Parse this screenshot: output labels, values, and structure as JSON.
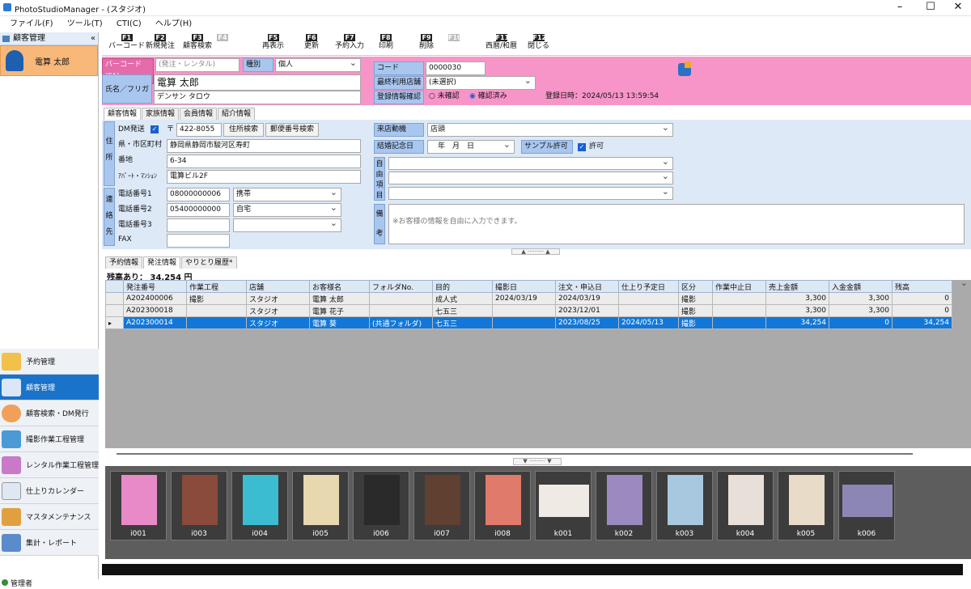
{
  "window": {
    "title": "PhotoStudioManager - (スタジオ)"
  },
  "menu": [
    "ファイル(F)",
    "ツール(T)",
    "CTI(C)",
    "ヘルプ(H)"
  ],
  "sidebar": {
    "header": "顧客管理",
    "collapse": "«",
    "customer_name": "電算 太郎",
    "nav": [
      {
        "label": "予約管理"
      },
      {
        "label": "顧客管理"
      },
      {
        "label": "顧客検索・DM発行"
      },
      {
        "label": "撮影作業工程管理"
      },
      {
        "label": "レンタル作業工程管理"
      },
      {
        "label": "仕上りカレンダー"
      },
      {
        "label": "マスタメンテナンス"
      },
      {
        "label": "集計・レポート"
      }
    ]
  },
  "fkeys": [
    {
      "key": "F1",
      "label": "バーコード"
    },
    {
      "key": "F2",
      "label": "新規発注"
    },
    {
      "key": "F3",
      "label": "顧客検索"
    },
    {
      "key": "F4",
      "label": ""
    },
    {
      "key": "F5",
      "label": "再表示"
    },
    {
      "key": "F6",
      "label": "更新"
    },
    {
      "key": "F7",
      "label": "予約入力"
    },
    {
      "key": "F8",
      "label": "印刷"
    },
    {
      "key": "F9",
      "label": "削除"
    },
    {
      "key": "F10",
      "label": ""
    },
    {
      "key": "F11",
      "label": "西暦/和暦"
    },
    {
      "key": "F12",
      "label": "閉じる"
    }
  ],
  "header": {
    "barcode_label": "バーコード(F1)",
    "barcode_placeholder": "(発注・レンタル)",
    "type_label": "種別",
    "type_value": "個人",
    "name_label": "氏名／フリガナ",
    "name": "電算 太郎",
    "kana": "デンサン タロウ",
    "code_label": "コード",
    "code": "0000030",
    "last_store_label": "最終利用店舗",
    "last_store": "(未選択)",
    "confirm_label": "登録情報確認",
    "unconfirmed": "未確認",
    "confirmed": "確認済み",
    "registered": "登録日時：2024/05/13 13:59:54"
  },
  "tabs_top": [
    "顧客情報",
    "家族情報",
    "会員情報",
    "紹介情報"
  ],
  "address": {
    "dm_label": "DM発送",
    "zip_mark": "〒",
    "zip": "422-8055",
    "btn_addr": "住所検索",
    "btn_zip": "郵便番号検索",
    "side": "住所",
    "pref_label": "県・市区町村",
    "pref": "静岡県静岡市駿河区寿町",
    "street_label": "番地",
    "street": "6-34",
    "apt_label": "ｱﾊﾟｰﾄ・ﾏﾝｼｮﾝ",
    "apt": "電算ビル2F"
  },
  "contact": {
    "side": "連絡先",
    "rows": [
      {
        "label": "電話番号1",
        "value": "08000000006",
        "type": "携帯"
      },
      {
        "label": "電話番号2",
        "value": "05400000000",
        "type": "自宅"
      },
      {
        "label": "電話番号3",
        "value": "",
        "type": ""
      },
      {
        "label": "FAX",
        "value": "",
        "type": null
      }
    ]
  },
  "right": {
    "visit_label": "来店動機",
    "visit": "店頭",
    "anniv_label": "結婚記念日",
    "anniv": "　年　月　日",
    "sample_label": "サンプル許可",
    "sample_value": "許可",
    "free_label": "自由項目",
    "memo_label": "備考",
    "memo_placeholder": "※お客様の情報を自由に入力できます。"
  },
  "tabs_bottom": [
    "予約情報",
    "発注情報",
    "やりとり履歴*"
  ],
  "balance": "残高あり： 34,254 円",
  "grid": {
    "columns": [
      "発注番号",
      "作業工程",
      "店舗",
      "お客様名",
      "フォルダNo.",
      "目的",
      "撮影日",
      "注文・申込日",
      "仕上り予定日",
      "区分",
      "作業中止日",
      "売上金額",
      "入金金額",
      "残高"
    ],
    "rows": [
      [
        "A202400006",
        "撮影",
        "スタジオ",
        "電算 太郎",
        "",
        "成人式",
        "2024/03/19",
        "2024/03/19",
        "",
        "撮影",
        "",
        "3,300",
        "3,300",
        "0"
      ],
      [
        "A202300018",
        "",
        "スタジオ",
        "電算 花子",
        "",
        "七五三",
        "",
        "2023/12/01",
        "",
        "撮影",
        "",
        "3,300",
        "3,300",
        "0"
      ],
      [
        "A202300014",
        "",
        "スタジオ",
        "電算 葵",
        "(共通フォルダ)",
        "七五三",
        "",
        "2023/08/25",
        "2024/05/13",
        "撮影",
        "",
        "34,254",
        "0",
        "34,254"
      ]
    ]
  },
  "thumbs": [
    {
      "label": "i001",
      "color": "#e88ac8"
    },
    {
      "label": "i003",
      "color": "#8a4a3c"
    },
    {
      "label": "i004",
      "color": "#3cbcd0"
    },
    {
      "label": "i005",
      "color": "#e8d8b0"
    },
    {
      "label": "i006",
      "color": "#2a2a2a"
    },
    {
      "label": "i007",
      "color": "#604030"
    },
    {
      "label": "i008",
      "color": "#e07a6a"
    },
    {
      "label": "k001",
      "color": "#f0eae4"
    },
    {
      "label": "k002",
      "color": "#9a8ac0"
    },
    {
      "label": "k003",
      "color": "#a8c8e0"
    },
    {
      "label": "k004",
      "color": "#e8e0d8"
    },
    {
      "label": "k005",
      "color": "#e8dcc8"
    },
    {
      "label": "k006",
      "color": "#8c86b4"
    }
  ],
  "status": "管理者"
}
